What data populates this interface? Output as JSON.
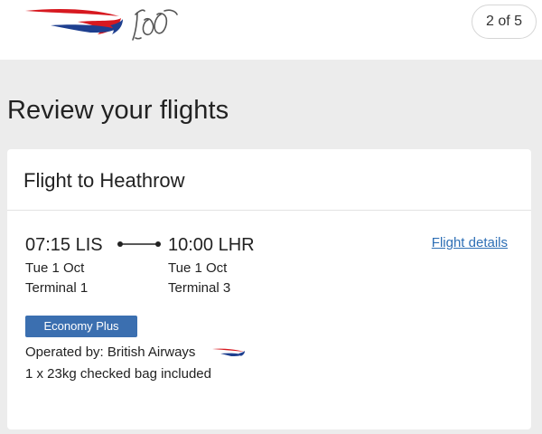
{
  "header": {
    "logo": "British Airways 100",
    "step_indicator": "2 of 5"
  },
  "page": {
    "title": "Review your flights"
  },
  "flight_card": {
    "title": "Flight to Heathrow",
    "departure": {
      "time": "07:15 LIS",
      "date": "Tue 1 Oct",
      "terminal": "Terminal 1"
    },
    "arrival": {
      "time": "10:00 LHR",
      "date": "Tue 1 Oct",
      "terminal": "Terminal 3"
    },
    "details_link": "Flight details",
    "cabin_class": "Economy Plus",
    "operated_by": "Operated by: British Airways",
    "baggage": "1 x 23kg checked bag included"
  },
  "icons": {
    "brand_logo": "ba-speedmarque-100-logo",
    "operator_logo": "ba-speedmarque-icon",
    "route": "route-line-icon"
  },
  "colors": {
    "link": "#2e6fb5",
    "badge": "#3b6fb0",
    "ba_red": "#d71920",
    "ba_blue": "#1e3f8f"
  }
}
